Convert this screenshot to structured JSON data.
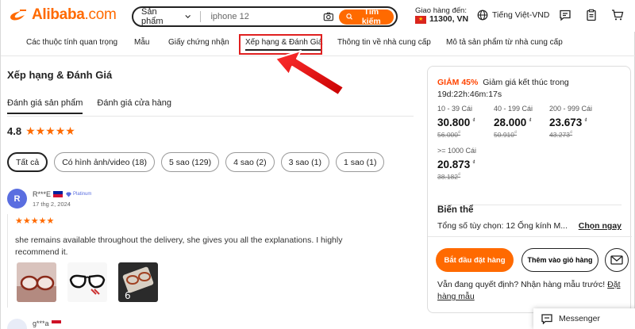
{
  "header": {
    "logo_text": "Alibaba",
    "logo_suffix": ".com",
    "search": {
      "category": "Sản phẩm",
      "query": "iphone 12",
      "button_label": "Tìm kiếm"
    },
    "ship_to": {
      "label": "Giao hàng đến:",
      "address": "11300, VN"
    },
    "language": "Tiếng Việt-VND"
  },
  "nav": {
    "items": [
      {
        "label": "Các thuộc tính quan trọng"
      },
      {
        "label": "Mẫu"
      },
      {
        "label": "Giấy chứng nhận"
      },
      {
        "label": "Xếp hạng & Đánh Giá"
      },
      {
        "label": "Thông tin về nhà cung cấp"
      },
      {
        "label": "Mô tả sản phẩm từ nhà cung cấp"
      }
    ]
  },
  "reviews": {
    "title": "Xếp hạng & Đánh Giá",
    "tabs": [
      {
        "label": "Đánh giá sản phẩm"
      },
      {
        "label": "Đánh giá cửa hàng"
      }
    ],
    "rating": {
      "value": "4.8",
      "stars": 5
    },
    "filters": [
      {
        "label": "Tất cả"
      },
      {
        "label": "Có hình ảnh/video (18)"
      },
      {
        "label": "5 sao (129)"
      },
      {
        "label": "4 sao (2)"
      },
      {
        "label": "3 sao (1)"
      },
      {
        "label": "1 sao (1)"
      }
    ],
    "items": [
      {
        "avatar_letter": "R",
        "name": "R***E",
        "badge": "Platinum",
        "date": "17 thg 2, 2024",
        "stars": 5,
        "text": "she remains available throughout the delivery, she gives you all the explanations. I highly recommend it."
      },
      {
        "name": "g***a"
      }
    ]
  },
  "panel": {
    "discount": "GIẢM 45%",
    "promo_text": "Giảm giá kết thúc trong",
    "countdown": "19d:22h:46m:17s",
    "tiers": [
      {
        "qty": "10 - 39 Cái",
        "price": "30.800",
        "old": "56.000"
      },
      {
        "qty": "40 - 199 Cái",
        "price": "28.000",
        "old": "50.910"
      },
      {
        "qty": "200 - 999 Cái",
        "price": "23.673",
        "old": "43.273"
      },
      {
        "qty": ">= 1000 Cái",
        "price": "20.873",
        "old": "38.182"
      }
    ],
    "currency": "₫",
    "variant_title": "Biến thể",
    "variant_text": "Tổng số tùy chọn: 12 Ống kính M...",
    "variant_select": "Chọn ngay",
    "start_order": "Bắt đầu đặt hàng",
    "add_to_cart": "Thêm vào giỏ hàng",
    "sample_text": "Vẫn đang quyết định? Nhận hàng mẫu trước!",
    "sample_link": "Đặt hàng mẫu"
  },
  "messenger": {
    "label": "Messenger"
  },
  "colors": {
    "accent": "#ff6a00",
    "annotation": "#e02020"
  }
}
